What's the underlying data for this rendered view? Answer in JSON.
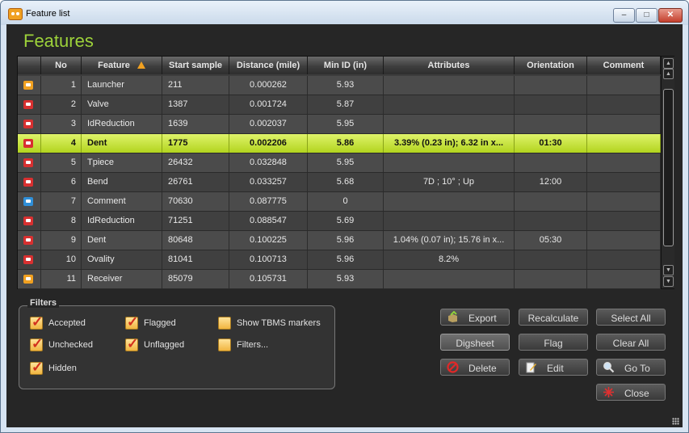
{
  "window": {
    "title": "Feature list",
    "minimize": "–",
    "maximize": "□",
    "close": "✕"
  },
  "heading": "Features",
  "table": {
    "columns": [
      {
        "key": "icon",
        "label": ""
      },
      {
        "key": "no",
        "label": "No"
      },
      {
        "key": "feature",
        "label": "Feature"
      },
      {
        "key": "start",
        "label": "Start sample"
      },
      {
        "key": "distance",
        "label": "Distance (mile)"
      },
      {
        "key": "minid",
        "label": "Min ID (in)"
      },
      {
        "key": "attributes",
        "label": "Attributes"
      },
      {
        "key": "orientation",
        "label": "Orientation"
      },
      {
        "key": "comment",
        "label": "Comment"
      }
    ],
    "sort_column": "feature",
    "rows": [
      {
        "icon": "launcher-icon",
        "icon_color": "#f0a020",
        "no": "1",
        "feature": "Launcher",
        "start": "211",
        "distance": "0.000262",
        "minid": "5.93",
        "attributes": "",
        "orientation": "",
        "comment": ""
      },
      {
        "icon": "valve-icon",
        "icon_color": "#d83030",
        "no": "2",
        "feature": "Valve",
        "start": "1387",
        "distance": "0.001724",
        "minid": "5.87",
        "attributes": "",
        "orientation": "",
        "comment": ""
      },
      {
        "icon": "id-reduction-icon",
        "icon_color": "#d83030",
        "no": "3",
        "feature": "IdReduction",
        "start": "1639",
        "distance": "0.002037",
        "minid": "5.95",
        "attributes": "",
        "orientation": "",
        "comment": ""
      },
      {
        "icon": "dent-icon",
        "icon_color": "#d83030",
        "no": "4",
        "feature": "Dent",
        "start": "1775",
        "distance": "0.002206",
        "minid": "5.86",
        "attributes": "3.39% (0.23 in); 6.32 in  x...",
        "orientation": "01:30",
        "comment": "",
        "selected": true
      },
      {
        "icon": "tpiece-icon",
        "icon_color": "#d83030",
        "no": "5",
        "feature": "Tpiece",
        "start": "26432",
        "distance": "0.032848",
        "minid": "5.95",
        "attributes": "",
        "orientation": "",
        "comment": ""
      },
      {
        "icon": "bend-icon",
        "icon_color": "#d83030",
        "no": "6",
        "feature": "Bend",
        "start": "26761",
        "distance": "0.033257",
        "minid": "5.68",
        "attributes": "7D ; 10° ; Up",
        "orientation": "12:00",
        "comment": ""
      },
      {
        "icon": "comment-icon",
        "icon_color": "#2f8fd8",
        "no": "7",
        "feature": "Comment",
        "start": "70630",
        "distance": "0.087775",
        "minid": "0",
        "attributes": "",
        "orientation": "",
        "comment": ""
      },
      {
        "icon": "id-reduction-icon",
        "icon_color": "#d83030",
        "no": "8",
        "feature": "IdReduction",
        "start": "71251",
        "distance": "0.088547",
        "minid": "5.69",
        "attributes": "",
        "orientation": "",
        "comment": ""
      },
      {
        "icon": "dent-icon",
        "icon_color": "#d83030",
        "no": "9",
        "feature": "Dent",
        "start": "80648",
        "distance": "0.100225",
        "minid": "5.96",
        "attributes": "1.04% (0.07 in); 15.76 in  x...",
        "orientation": "05:30",
        "comment": ""
      },
      {
        "icon": "ovality-icon",
        "icon_color": "#d83030",
        "no": "10",
        "feature": "Ovality",
        "start": "81041",
        "distance": "0.100713",
        "minid": "5.96",
        "attributes": "8.2%",
        "orientation": "",
        "comment": ""
      },
      {
        "icon": "receiver-icon",
        "icon_color": "#f0a020",
        "no": "11",
        "feature": "Receiver",
        "start": "85079",
        "distance": "0.105731",
        "minid": "5.93",
        "attributes": "",
        "orientation": "",
        "comment": ""
      }
    ]
  },
  "filters": {
    "title": "Filters",
    "items": [
      {
        "label": "Accepted",
        "checked": true
      },
      {
        "label": "Flagged",
        "checked": true
      },
      {
        "label": "Show TBMS markers",
        "checked": false
      },
      {
        "label": "Unchecked",
        "checked": true
      },
      {
        "label": "Unflagged",
        "checked": true
      },
      {
        "label": "Filters...",
        "checked": false
      },
      {
        "label": "Hidden",
        "checked": true
      }
    ]
  },
  "buttons": {
    "export": "Export",
    "recalculate": "Recalculate",
    "select_all": "Select All",
    "digsheet": "Digsheet",
    "flag": "Flag",
    "clear_all": "Clear All",
    "delete": "Delete",
    "edit": "Edit",
    "go_to": "Go To",
    "close": "Close"
  },
  "colors": {
    "accent": "#9dd23a",
    "selected_row": "#c8e43a",
    "background": "#262626"
  }
}
